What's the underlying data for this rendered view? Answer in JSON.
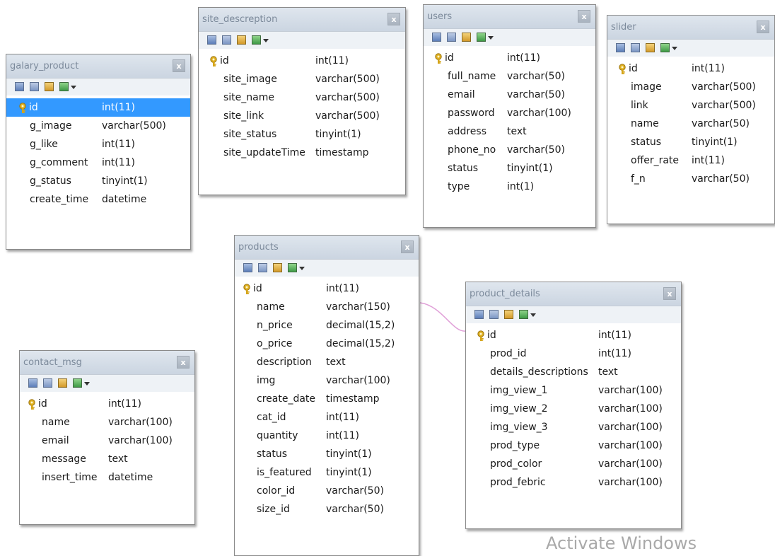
{
  "colors": {
    "selected_row": "#3399ff",
    "header_bg": "#d4dce6",
    "relation_line": "#e0a0d8"
  },
  "icons": [
    "table-data-icon",
    "table-structure-icon",
    "table-key-icon",
    "table-export-icon",
    "dropdown-caret-icon",
    "primary-key-icon",
    "close-icon"
  ],
  "tables": {
    "galary_product": {
      "title": "galary_product",
      "close": "x",
      "columns": [
        {
          "name": "id",
          "type": "int(11)",
          "pk": true,
          "selected": true
        },
        {
          "name": "g_image",
          "type": "varchar(500)"
        },
        {
          "name": "g_like",
          "type": "int(11)"
        },
        {
          "name": "g_comment",
          "type": "int(11)"
        },
        {
          "name": "g_status",
          "type": "tinyint(1)"
        },
        {
          "name": "create_time",
          "type": "datetime"
        }
      ]
    },
    "site_descreption": {
      "title": "site_descreption",
      "close": "x",
      "columns": [
        {
          "name": "id",
          "type": "int(11)",
          "pk": true
        },
        {
          "name": "site_image",
          "type": "varchar(500)"
        },
        {
          "name": "site_name",
          "type": "varchar(500)"
        },
        {
          "name": "site_link",
          "type": "varchar(500)"
        },
        {
          "name": "site_status",
          "type": "tinyint(1)"
        },
        {
          "name": "site_updateTime",
          "type": "timestamp"
        }
      ]
    },
    "users": {
      "title": "users",
      "close": "x",
      "columns": [
        {
          "name": "id",
          "type": "int(11)",
          "pk": true
        },
        {
          "name": "full_name",
          "type": "varchar(50)"
        },
        {
          "name": "email",
          "type": "varchar(50)"
        },
        {
          "name": "password",
          "type": "varchar(100)"
        },
        {
          "name": "address",
          "type": "text"
        },
        {
          "name": "phone_no",
          "type": "varchar(50)"
        },
        {
          "name": "status",
          "type": "tinyint(1)"
        },
        {
          "name": "type",
          "type": "int(1)"
        }
      ]
    },
    "slider": {
      "title": "slider",
      "close": "x",
      "columns": [
        {
          "name": "id",
          "type": "int(11)",
          "pk": true
        },
        {
          "name": "image",
          "type": "varchar(500)"
        },
        {
          "name": "link",
          "type": "varchar(500)"
        },
        {
          "name": "name",
          "type": "varchar(50)"
        },
        {
          "name": "status",
          "type": "tinyint(1)"
        },
        {
          "name": "offer_rate",
          "type": "int(11)"
        },
        {
          "name": "f_n",
          "type": "varchar(50)"
        }
      ]
    },
    "products": {
      "title": "products",
      "close": "x",
      "columns": [
        {
          "name": "id",
          "type": "int(11)",
          "pk": true
        },
        {
          "name": "name",
          "type": "varchar(150)"
        },
        {
          "name": "n_price",
          "type": "decimal(15,2)"
        },
        {
          "name": "o_price",
          "type": "decimal(15,2)"
        },
        {
          "name": "description",
          "type": "text"
        },
        {
          "name": "img",
          "type": "varchar(100)"
        },
        {
          "name": "create_date",
          "type": "timestamp"
        },
        {
          "name": "cat_id",
          "type": "int(11)"
        },
        {
          "name": "quantity",
          "type": "int(11)"
        },
        {
          "name": "status",
          "type": "tinyint(1)"
        },
        {
          "name": "is_featured",
          "type": "tinyint(1)"
        },
        {
          "name": "color_id",
          "type": "varchar(50)"
        },
        {
          "name": "size_id",
          "type": "varchar(50)"
        }
      ]
    },
    "product_details": {
      "title": "product_details",
      "close": "x",
      "columns": [
        {
          "name": "id",
          "type": "int(11)",
          "pk": true
        },
        {
          "name": "prod_id",
          "type": "int(11)"
        },
        {
          "name": "details_descriptions",
          "type": "text"
        },
        {
          "name": "img_view_1",
          "type": "varchar(100)"
        },
        {
          "name": "img_view_2",
          "type": "varchar(100)"
        },
        {
          "name": "img_view_3",
          "type": "varchar(100)"
        },
        {
          "name": "prod_type",
          "type": "varchar(100)"
        },
        {
          "name": "prod_color",
          "type": "varchar(100)"
        },
        {
          "name": "prod_febric",
          "type": "varchar(100)"
        }
      ]
    },
    "contact_msg": {
      "title": "contact_msg",
      "close": "x",
      "columns": [
        {
          "name": "id",
          "type": "int(11)",
          "pk": true
        },
        {
          "name": "name",
          "type": "varchar(100)"
        },
        {
          "name": "email",
          "type": "varchar(100)"
        },
        {
          "name": "message",
          "type": "text"
        },
        {
          "name": "insert_time",
          "type": "datetime"
        }
      ]
    }
  },
  "watermark": "Activate Windows"
}
